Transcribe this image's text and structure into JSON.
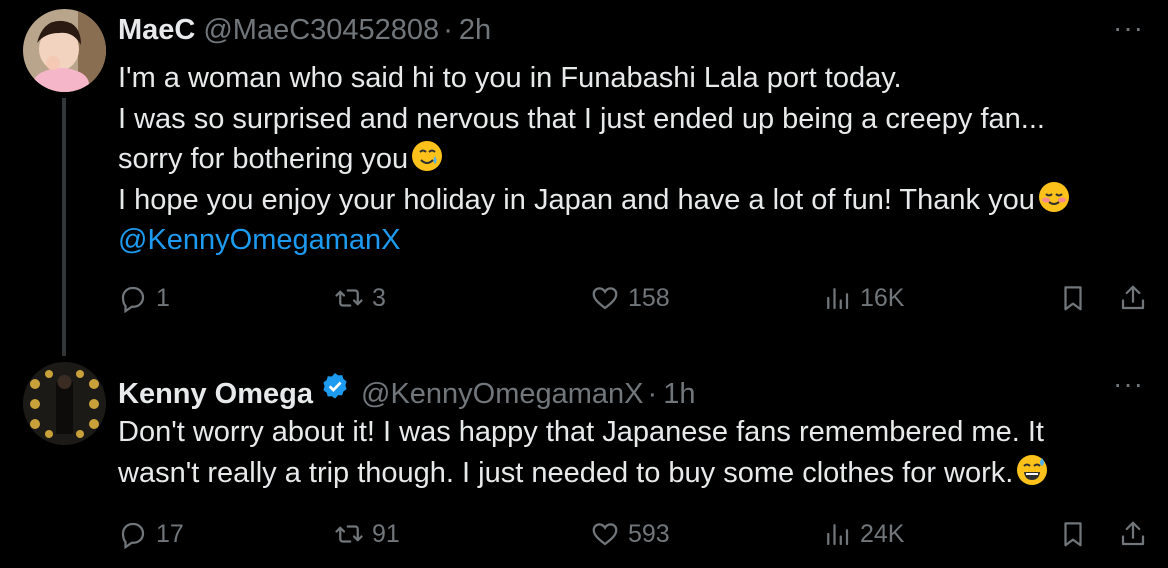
{
  "tweets": [
    {
      "name": "MaeC",
      "handle": "@MaeC30452808",
      "separator": "·",
      "time": "2h",
      "lines": [
        "I'm a woman who said hi to you in Funabashi Lala port today.",
        "I was so surprised and nervous that I just ended up being a creepy fan...",
        "sorry for bothering you",
        "I hope you enjoy your holiday in Japan and have a lot of fun! Thank you"
      ],
      "mention": "@KennyOmegamanX",
      "emoji_1": "smiling-face-with-tear-emoji",
      "emoji_2": "smiling-face-blushing-emoji",
      "replies": "1",
      "reposts": "3",
      "likes": "158",
      "views": "16K",
      "more": "···"
    },
    {
      "name": "Kenny Omega",
      "handle": "@KennyOmegamanX",
      "separator": "·",
      "time": "1h",
      "verified": true,
      "lines": [
        "Don't worry about it! I was happy that Japanese fans remembered me. It",
        "wasn't really a trip though. I just needed to buy some clothes for work."
      ],
      "emoji_1": "grinning-face-with-sweat-emoji",
      "replies": "17",
      "reposts": "91",
      "likes": "593",
      "views": "24K",
      "more": "···"
    }
  ],
  "colors": {
    "background": "#000000",
    "text": "#e7e9ea",
    "muted": "#71767b",
    "link": "#1d9bf0",
    "thread_line": "#333639"
  }
}
